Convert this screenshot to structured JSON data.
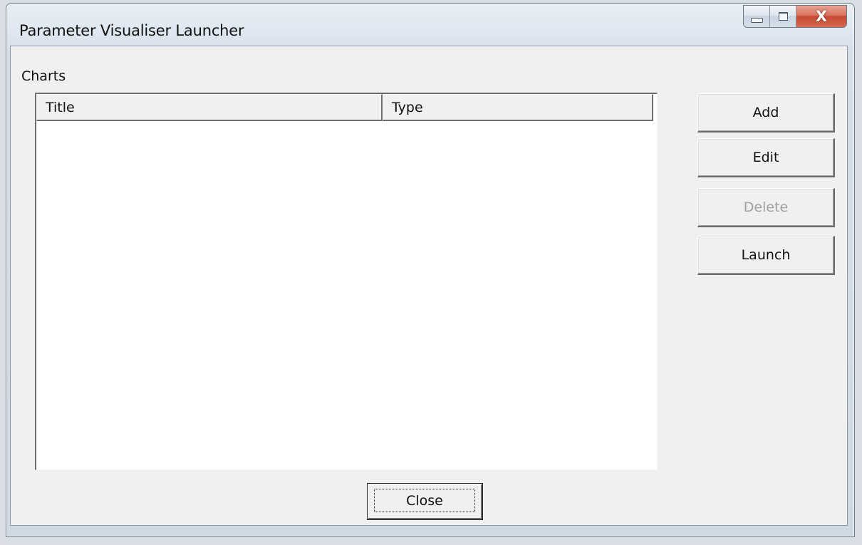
{
  "window": {
    "title": "Parameter Visualiser Launcher",
    "controls": {
      "minimize_icon": "minimize-icon",
      "maximize_icon": "maximize-icon",
      "close_glyph": "X"
    }
  },
  "charts_group": {
    "label": "Charts",
    "columns": [
      "Title",
      "Type"
    ],
    "rows": []
  },
  "actions": {
    "add_label": "Add",
    "edit_label": "Edit",
    "delete_label": "Delete",
    "launch_label": "Launch"
  },
  "footer": {
    "close_label": "Close"
  },
  "colors": {
    "dialog_background": "#f0f0f0",
    "list_background": "#ffffff",
    "disabled_text": "#a0a0a0",
    "close_button_red": "#c64a34"
  }
}
